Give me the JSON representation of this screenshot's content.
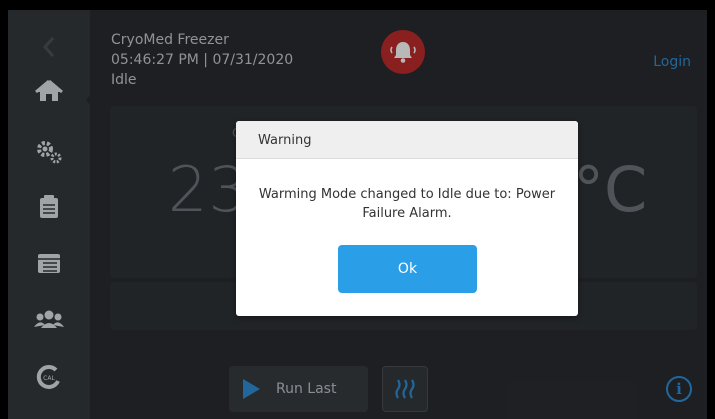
{
  "header": {
    "device_name": "CryoMed Freezer",
    "datetime": "05:46:27 PM | 07/31/2020",
    "status": "Idle",
    "login_label": "Login"
  },
  "main": {
    "temperature_left": "23",
    "temperature_right": "°C",
    "small_label": "C"
  },
  "controls": {
    "run_last_label": "Run Last",
    "info_label": "i"
  },
  "dialog": {
    "title": "Warning",
    "message": "Warming Mode changed to Idle due to: Power Failure Alarm.",
    "ok_label": "Ok"
  },
  "colors": {
    "accent": "#2e8fd8",
    "alarm": "#c02b2b",
    "ok_button": "#2a9fe8",
    "background": "#292c30",
    "sidebar": "#35393e"
  },
  "icons": [
    "back-chevron-icon",
    "home-icon",
    "settings-gears-icon",
    "clipboard-icon",
    "calendar-icon",
    "users-icon",
    "calibration-icon",
    "alarm-bell-icon",
    "play-icon",
    "heat-waves-icon",
    "info-icon"
  ]
}
